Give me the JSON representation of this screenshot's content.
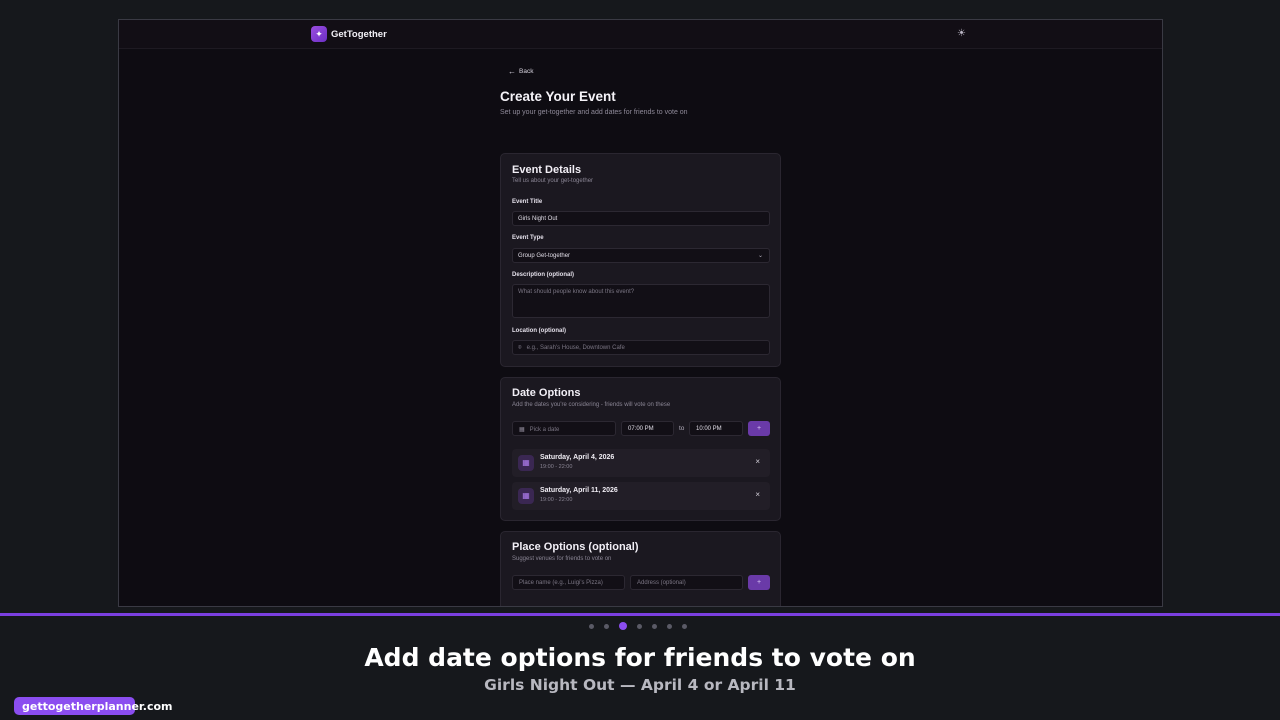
{
  "app": {
    "name": "GetTogether",
    "theme_toggle_icon": "sun-icon"
  },
  "page": {
    "back_label": "Back",
    "title": "Create Your Event",
    "subtitle": "Set up your get-together and add dates for friends to vote on"
  },
  "event_details": {
    "title": "Event Details",
    "subtitle": "Tell us about your get-together",
    "event_title_label": "Event Title",
    "event_title_value": "Girls Night Out",
    "event_type_label": "Event Type",
    "event_type_value": "Group Get-together",
    "description_label": "Description (optional)",
    "description_placeholder": "What should people know about this event?",
    "location_label": "Location (optional)",
    "location_placeholder": "e.g., Sarah's House, Downtown Cafe"
  },
  "date_options": {
    "title": "Date Options",
    "subtitle": "Add the dates you're considering - friends will vote on these",
    "date_placeholder": "Pick a date",
    "start_time": "07:00 PM",
    "to_label": "to",
    "end_time": "10:00 PM",
    "add_label": "+",
    "items": [
      {
        "date": "Saturday, April 4, 2026",
        "time": "19:00 - 22:00"
      },
      {
        "date": "Saturday, April 11, 2026",
        "time": "19:00 - 22:00"
      }
    ],
    "remove_label": "×"
  },
  "place_options": {
    "title": "Place Options (optional)",
    "subtitle": "Suggest venues for friends to vote on",
    "place_placeholder": "Place name (e.g., Luigi's Pizza)",
    "address_placeholder": "Address (optional)",
    "add_label": "+"
  },
  "overlay": {
    "caption": "Add date options for friends to vote on",
    "subcaption": "Girls Night Out — April 4 or April 11",
    "url": "gettogetherplanner.com",
    "step_count": 7,
    "active_step": 3,
    "accent_color": "#8b4df0"
  }
}
